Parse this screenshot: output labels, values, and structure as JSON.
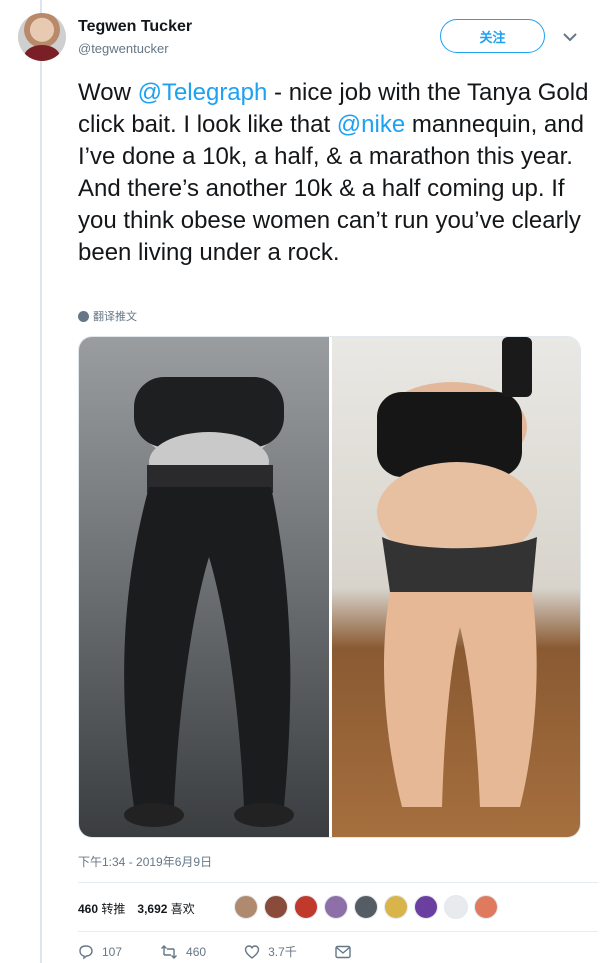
{
  "author": {
    "display_name": "Tegwen Tucker",
    "handle": "@tegwentucker"
  },
  "follow_label": "关注",
  "tweet": {
    "text_1": "Wow ",
    "mention_1": "@Telegraph",
    "text_2": " - nice job with the Tanya Gold click bait. I look like that ",
    "mention_2": "@nike",
    "text_3": " mannequin, and I’ve done a 10k, a half, & a marathon this year. And there’s another 10k & a half coming up. If you think obese women can’t run you’ve clearly been living under a rock."
  },
  "translate_label": "翻译推文",
  "timestamp": "下午1:34 - 2019年6月9日",
  "stats": {
    "retweets_count": "460",
    "retweets_label": "转推",
    "likes_count": "3,692",
    "likes_label": "喜欢"
  },
  "actions": {
    "reply_count": "107",
    "retweet_count": "460",
    "like_count": "3.7千"
  },
  "colors": {
    "accent": "#1da1f2",
    "muted": "#657786"
  }
}
